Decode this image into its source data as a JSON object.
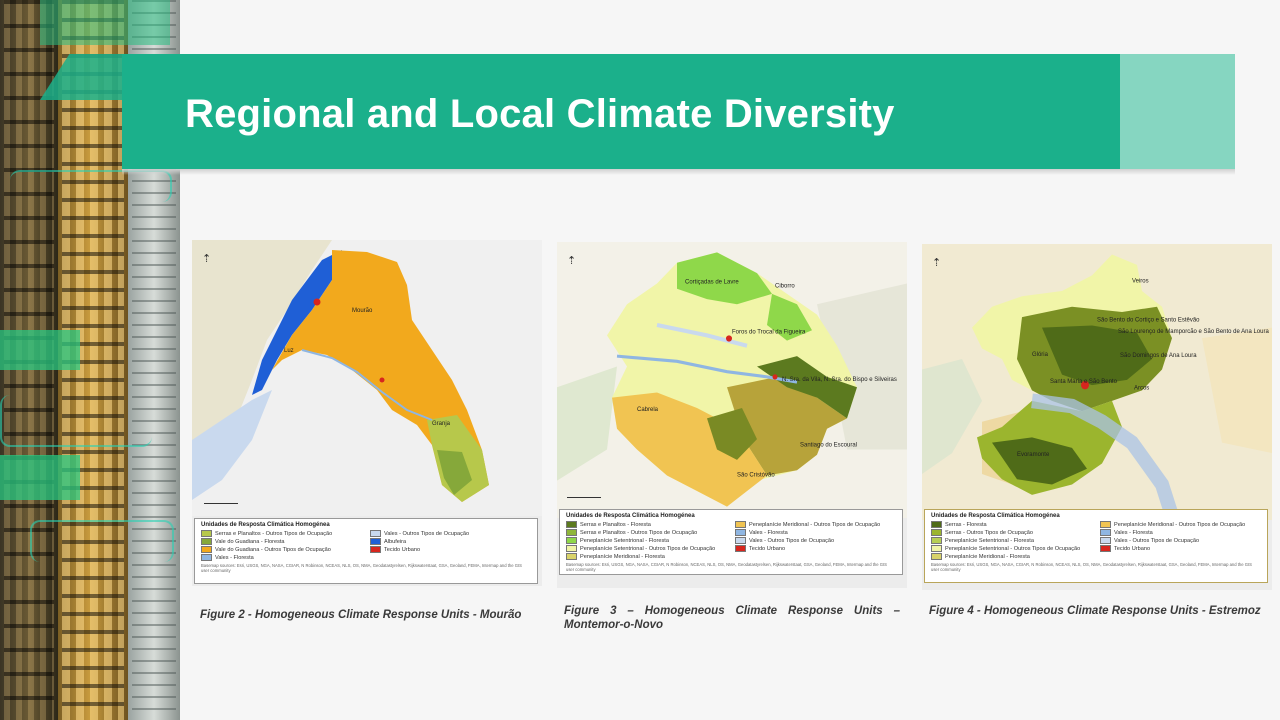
{
  "slide": {
    "title": "Regional and Local Climate Diversity",
    "colors": {
      "banner": "#1bb08b",
      "banner_end": "#86d6c1",
      "background": "#f6f6f6"
    }
  },
  "figures": [
    {
      "caption": "Figure 2 - Homogeneous Climate Response Units - Mourão",
      "map_labels": [
        "Mourão",
        "Luz",
        "Granja"
      ],
      "legend": {
        "title": "Unidades de Resposta Climática Homogénea",
        "items": [
          {
            "label": "Serras e Planaltos - Outros Tipos de Ocupação",
            "color": "#b7c84b"
          },
          {
            "label": "Vales - Outros Tipos de Ocupação",
            "color": "#c9d9ee"
          },
          {
            "label": "Vale do Guadiana - Floresta",
            "color": "#86a83a"
          },
          {
            "label": "Albufeira",
            "color": "#1f5fd6"
          },
          {
            "label": "Vale do Guadiana - Outros Tipos de Ocupação",
            "color": "#f2a91d"
          },
          {
            "label": "Tecido Urbano",
            "color": "#d7261e"
          },
          {
            "label": "Vales - Floresta",
            "color": "#8fb6e2"
          }
        ],
        "source": "Basemap sources: Esri, USGS, NGA, NASA, CGIAR, N Robinson, NCEAS, NLS, OS, NMA, Geodatastyrelsen, Rijkswaterstaat, GSA, Geoland, FEMA, Intermap and the GIS user community"
      }
    },
    {
      "caption": "Figure 3 – Homogeneous Climate Response Units – Montemor-o-Novo",
      "map_labels": [
        "Cortiçadas de Lavre",
        "Ciborro",
        "Foros do Trocal da Figueira",
        "N. Sra. da Vila, N. Sra. do Bispo e Silveiras",
        "Cabrela",
        "Santiago do Escoural",
        "São Cristóvão"
      ],
      "legend": {
        "title": "Unidades de Resposta Climática Homogénea",
        "items": [
          {
            "label": "Serras e Planaltos - Floresta",
            "color": "#5c7a1f"
          },
          {
            "label": "Peneplanície Meridional - Outros Tipos de Ocupação",
            "color": "#f1c452"
          },
          {
            "label": "Serras e Planaltos - Outros Tipos de Ocupação",
            "color": "#8fb63a"
          },
          {
            "label": "Vales - Floresta",
            "color": "#8fb6e2"
          },
          {
            "label": "Peneplanície Setentrional - Floresta",
            "color": "#8fd84a"
          },
          {
            "label": "Vales - Outros Tipos de Ocupação",
            "color": "#c9d9ee"
          },
          {
            "label": "Peneplanície Setentrional - Outros Tipos de Ocupação",
            "color": "#f1f5a8"
          },
          {
            "label": "Tecido Urbano",
            "color": "#d7261e"
          },
          {
            "label": "Peneplanície Meridional - Floresta",
            "color": "#d9d36a"
          }
        ],
        "source": "Basemap sources: Esri, USGS, NGA, NASA, CGIAR, N Robinson, NCEAS, NLS, OS, NMA, Geodatastyrelsen, Rijkswaterstaat, GSA, Geoland, FEMA, Intermap and the GIS user community"
      }
    },
    {
      "caption": "Figure 4 - Homogeneous Climate Response Units - Estremoz",
      "map_labels": [
        "Veiros",
        "São Bento do Cortiço e Santo Estêvão",
        "São Lourenço de Mamporcão e São Bento de Ana Loura",
        "Arcos",
        "Glória",
        "Santa Maria e São Bento",
        "São Domingos de Ana Loura",
        "Evoramonte"
      ],
      "legend": {
        "title": "Unidades de Resposta Climática Homogénea",
        "items": [
          {
            "label": "Serras - Floresta",
            "color": "#4f6b18"
          },
          {
            "label": "Peneplanície Meridional - Outros Tipos de Ocupação",
            "color": "#f1c452"
          },
          {
            "label": "Serras - Outros Tipos de Ocupação",
            "color": "#9bb52e"
          },
          {
            "label": "Vales - Floresta",
            "color": "#8fb6e2"
          },
          {
            "label": "Peneplanície Setentrional - Floresta",
            "color": "#b7cf55"
          },
          {
            "label": "Vales - Outros Tipos de Ocupação",
            "color": "#c9d9ee"
          },
          {
            "label": "Peneplanície Setentrional - Outros Tipos de Ocupação",
            "color": "#f1f5a8"
          },
          {
            "label": "Tecido Urbano",
            "color": "#d7261e"
          },
          {
            "label": "Peneplanície Meridional - Floresta",
            "color": "#d9d36a"
          }
        ],
        "source": "Basemap sources: Esri, USGS, NGA, NASA, CGIAR, N Robinson, NCEAS, NLS, OS, NMA, Geodatastyrelsen, Rijkswaterstaat, GSA, Geoland, FEMA, Intermap and the GIS user community"
      }
    }
  ]
}
